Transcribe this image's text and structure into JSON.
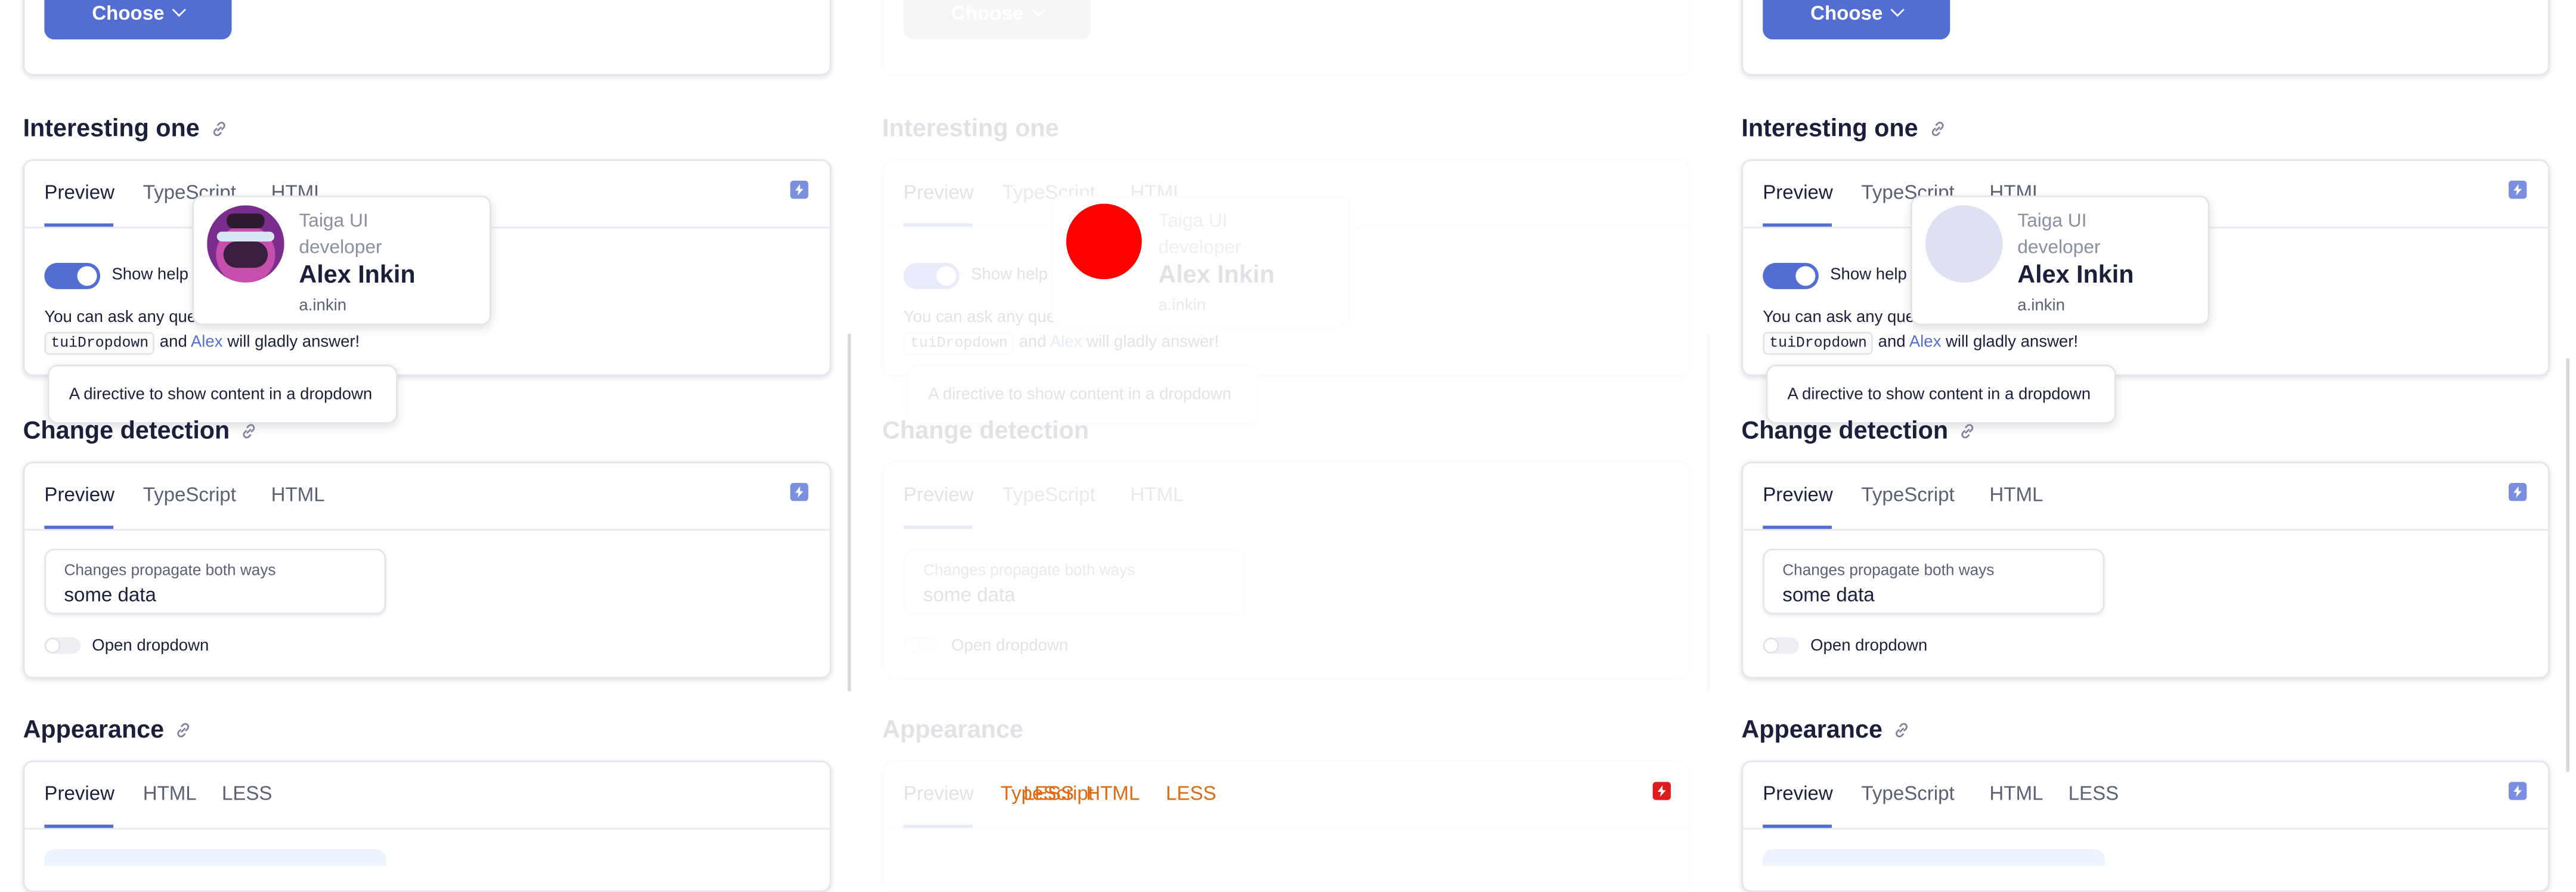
{
  "top": {
    "choose_label": "Choose"
  },
  "sections": {
    "interesting": {
      "title": "Interesting one",
      "tabs": [
        "Preview",
        "TypeScript",
        "HTML"
      ],
      "toggle_label": "Show help",
      "text_before": "You can ask any ques",
      "code": "tuiDropdown",
      "and": "and",
      "link": "Alex",
      "text_after": "will gladly answer!",
      "hint": "A directive to show content in a dropdown",
      "card": {
        "role": "Taiga UI developer",
        "name": "Alex Inkin",
        "handle": "a.inkin"
      }
    },
    "change": {
      "title": "Change detection",
      "tabs": [
        "Preview",
        "TypeScript",
        "HTML"
      ],
      "field_label": "Changes propagate both ways",
      "field_value": "some data",
      "toggle_label": "Open dropdown"
    },
    "appearance": {
      "title": "Appearance",
      "tabs_first": [
        "Preview",
        "HTML",
        "LESS"
      ],
      "tabs_third": [
        "Preview",
        "TypeScript",
        "HTML",
        "LESS"
      ],
      "overlay_tabs": [
        "TypeScript",
        "LESS",
        "HTML",
        "LESS"
      ]
    }
  },
  "colors": {
    "primary": "#526ed3",
    "overlay_red": "#ff0000",
    "overlay_orange": "#e06a14"
  }
}
